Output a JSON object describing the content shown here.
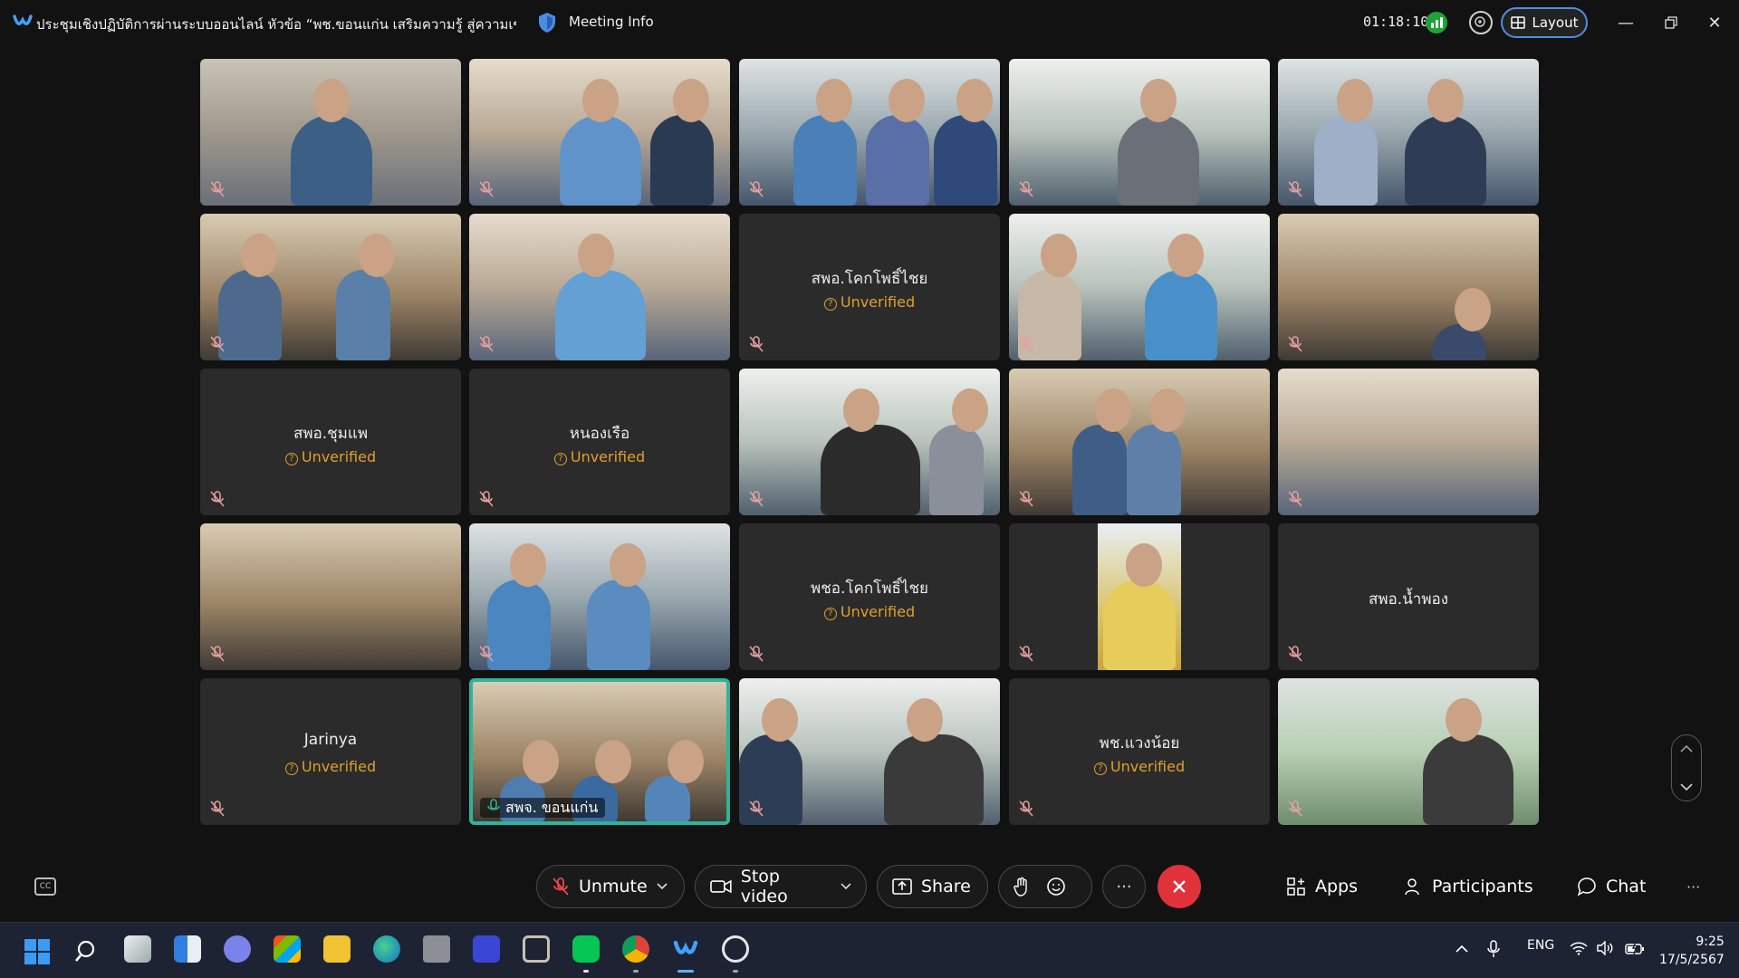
{
  "titlebar": {
    "meeting_title": "ประชุมเชิงปฏิบัติการผ่านระบบออนไลน์ หัวข้อ “พช.ขอนแก่น เสริมความรู้ สู่ความเข้...",
    "meeting_info": "Meeting Info",
    "elapsed": "01:18:10",
    "layout_label": "Layout"
  },
  "tiles": {
    "r1c1": {
      "type": "video"
    },
    "r1c2": {
      "type": "video"
    },
    "r1c3": {
      "type": "video"
    },
    "r1c4": {
      "type": "video"
    },
    "r1c5": {
      "type": "video"
    },
    "r2c1": {
      "type": "video"
    },
    "r2c2": {
      "type": "video"
    },
    "r2c3": {
      "name": "สพอ.โคกโพธิ์ไชย",
      "status": "Unverified"
    },
    "r2c4": {
      "type": "video"
    },
    "r2c5": {
      "type": "video"
    },
    "r3c1": {
      "name": "สพอ.ชุมแพ",
      "status": "Unverified"
    },
    "r3c2": {
      "name": "หนองเรือ",
      "status": "Unverified"
    },
    "r3c3": {
      "type": "video"
    },
    "r3c4": {
      "type": "video"
    },
    "r3c5": {
      "type": "video"
    },
    "r4c1": {
      "type": "video"
    },
    "r4c2": {
      "type": "video"
    },
    "r4c3": {
      "name": "พชอ.โคกโพธิ์ไชย",
      "status": "Unverified"
    },
    "r4c4": {
      "type": "video"
    },
    "r4c5": {
      "name": "สพอ.น้ำพอง"
    },
    "r5c1": {
      "name": "Jarinya",
      "status": "Unverified"
    },
    "r5c2": {
      "name": "สพจ. ขอนแก่น",
      "active_speaker": true
    },
    "r5c3": {
      "type": "video"
    },
    "r5c4": {
      "name": "พช.แวงน้อย",
      "status": "Unverified"
    },
    "r5c5": {
      "type": "video"
    }
  },
  "controls": {
    "unmute": "Unmute",
    "stop_video": "Stop video",
    "share": "Share",
    "more": "···",
    "apps": "Apps",
    "participants": "Participants",
    "chat": "Chat",
    "overflow": "···"
  },
  "taskbar": {
    "language": "ENG",
    "time": "9:25",
    "date": "17/5/2567"
  },
  "colors": {
    "active_speaker": "#2fb39a",
    "end_call": "#e0323a",
    "unverified": "#e0a02a",
    "layout_border": "#4d8ee6"
  }
}
